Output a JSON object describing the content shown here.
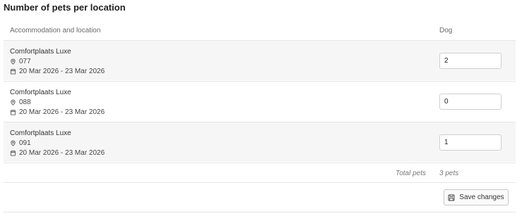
{
  "title": "Number of pets per location",
  "table": {
    "headers": {
      "accommodation": "Accommodation and location",
      "dog": "Dog"
    },
    "rows": [
      {
        "name": "Comfortplaats Luxe",
        "location": "077",
        "dates": "20 Mar 2026 - 23 Mar 2026",
        "dog_count": "2"
      },
      {
        "name": "Comfortplaats Luxe",
        "location": "088",
        "dates": "20 Mar 2026 - 23 Mar 2026",
        "dog_count": "0"
      },
      {
        "name": "Comfortplaats Luxe",
        "location": "091",
        "dates": "20 Mar 2026 - 23 Mar 2026",
        "dog_count": "1"
      }
    ],
    "total_label": "Total pets",
    "total_value": "3 pets"
  },
  "actions": {
    "save_label": "Save changes"
  },
  "icons": {
    "location": "map-pin-icon",
    "date": "calendar-icon",
    "save": "save-icon"
  }
}
